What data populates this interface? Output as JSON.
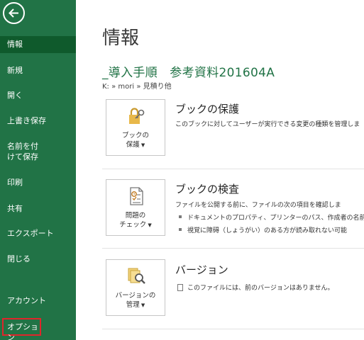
{
  "sidebar": {
    "items": [
      {
        "label": "情報"
      },
      {
        "label": "新規"
      },
      {
        "label": "開く"
      },
      {
        "label": "上書き保存"
      },
      {
        "label": "名前を付けて保存"
      },
      {
        "label": "印刷"
      },
      {
        "label": "共有"
      },
      {
        "label": "エクスポート"
      },
      {
        "label": "閉じる"
      },
      {
        "label": "アカウント"
      },
      {
        "label": "オプション"
      }
    ]
  },
  "main": {
    "title": "情報",
    "file_name": "_導入手順　参考資料201604A",
    "path": "K: » mori » 見積り他",
    "protect": {
      "button_line1": "ブックの",
      "button_line2": "保護",
      "title": "ブックの保護",
      "description": "このブックに対してユーザーが実行できる変更の種類を管理しま"
    },
    "inspect": {
      "button_line1": "問題の",
      "button_line2": "チェック",
      "title": "ブックの検査",
      "description": "ファイルを公開する前に、ファイルの次の項目を確認しま",
      "bullets": [
        "ドキュメントのプロパティ、プリンターのパス、作成者の名前",
        "視覚に障碍（しょうがい）のある方が読み取れない可能"
      ]
    },
    "versions": {
      "button_line1": "バージョンの",
      "button_line2": "管理",
      "title": "バージョン",
      "description": "このファイルには、前のバージョンはありません。"
    }
  },
  "colors": {
    "accent": "#217346",
    "highlight_border": "#e0252b"
  }
}
